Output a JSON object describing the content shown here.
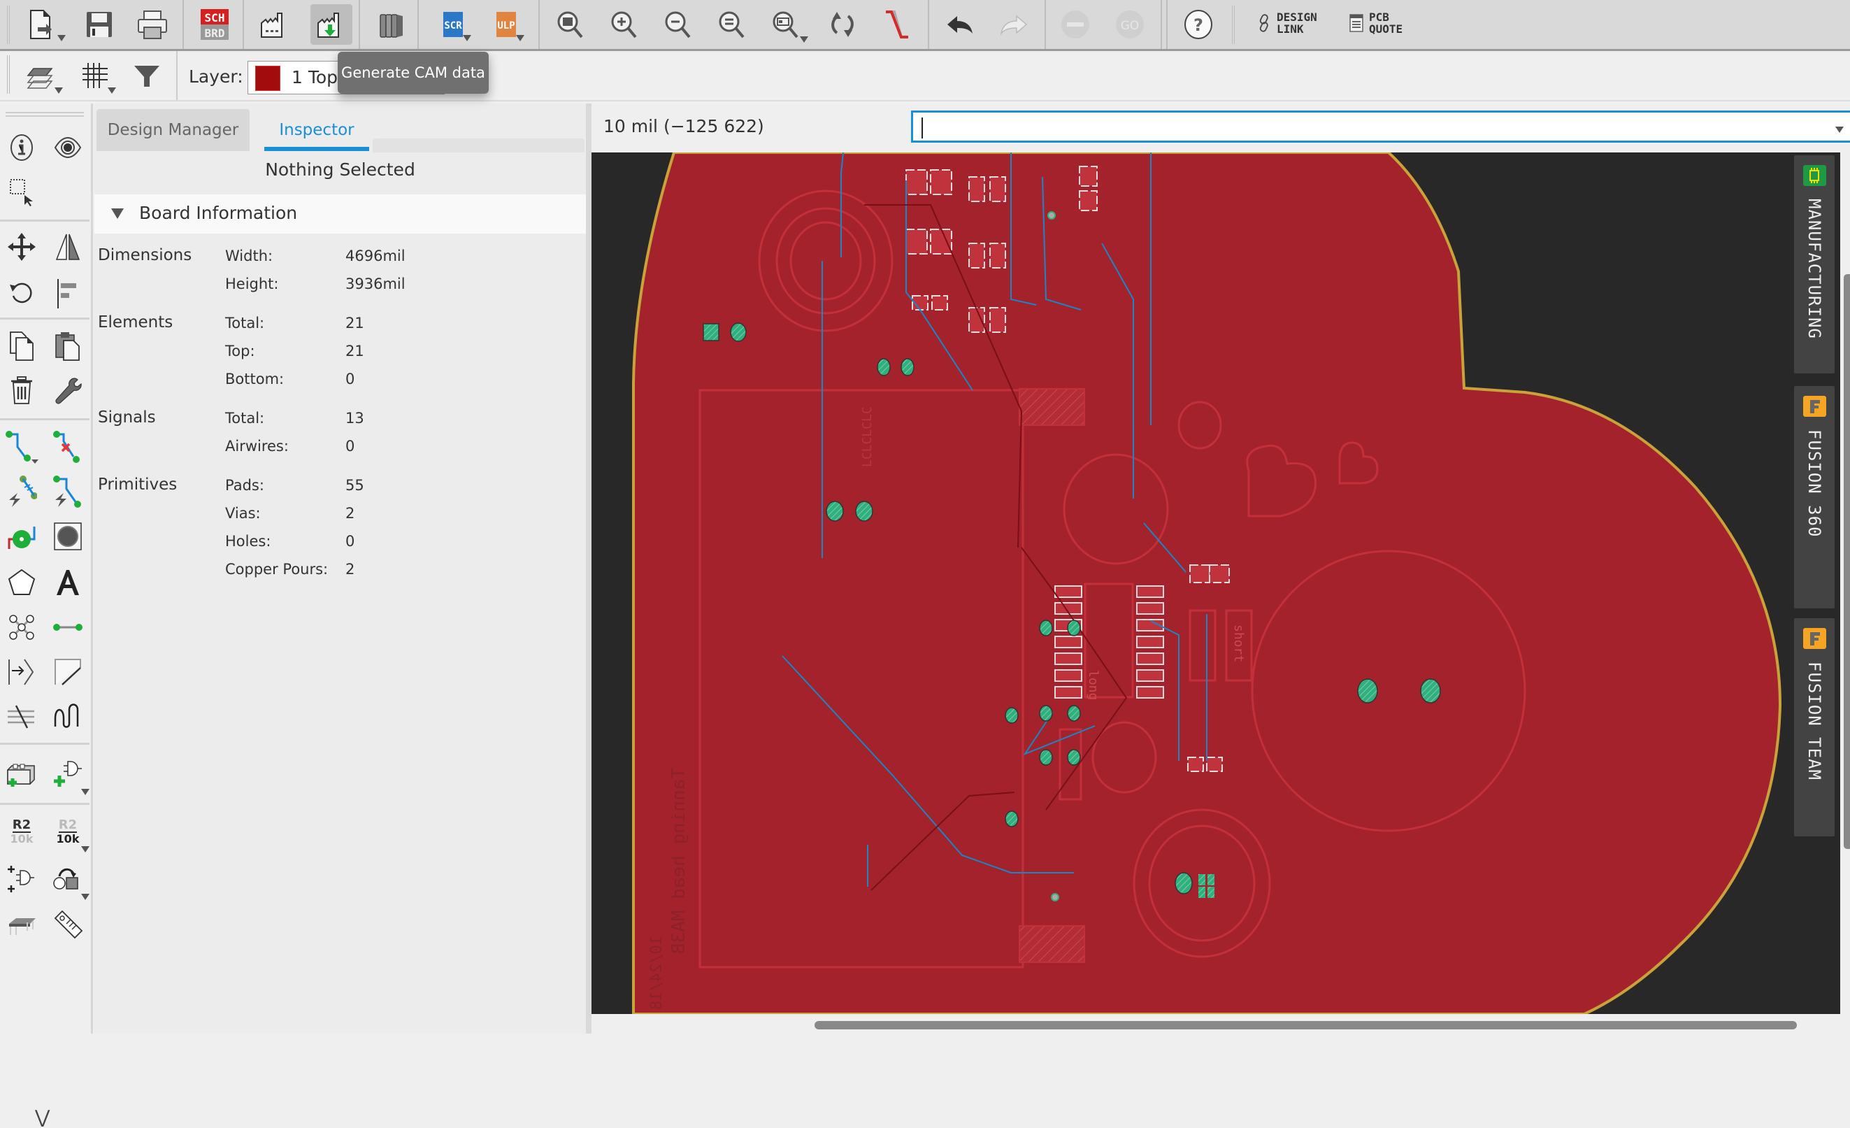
{
  "toolbar": {
    "buttons": [
      {
        "name": "new-file",
        "tooltip": ""
      },
      {
        "name": "save",
        "tooltip": ""
      },
      {
        "name": "print",
        "tooltip": ""
      },
      {
        "name": "sch-brd-switch",
        "label_top": "SCH",
        "label_bottom": "BRD"
      },
      {
        "name": "cam-processor"
      },
      {
        "name": "generate-cam-data",
        "active": true
      },
      {
        "name": "library-manager"
      },
      {
        "name": "run-script",
        "label": "SCR"
      },
      {
        "name": "run-ulp",
        "label": "ULP"
      },
      {
        "name": "zoom-to-fit"
      },
      {
        "name": "zoom-in"
      },
      {
        "name": "zoom-out"
      },
      {
        "name": "zoom-reset"
      },
      {
        "name": "zoom-select"
      },
      {
        "name": "redraw"
      },
      {
        "name": "ratsnest"
      },
      {
        "name": "undo"
      },
      {
        "name": "redo",
        "disabled": true
      },
      {
        "name": "stop",
        "disabled": true
      },
      {
        "name": "go",
        "label": "GO",
        "disabled": true
      },
      {
        "name": "help",
        "label": "?"
      }
    ],
    "design_link": {
      "line1": "DESIGN",
      "line2": "LINK"
    },
    "pcb_quote": {
      "line1": "PCB",
      "line2": "QUOTE"
    }
  },
  "toolbar2": {
    "layer_label": "Layer:",
    "layer_value": "1 Top",
    "layer_color": "#a30c0c"
  },
  "tooltip": "Generate CAM data",
  "inspector": {
    "tabs": [
      {
        "label": "Design Manager",
        "active": false
      },
      {
        "label": "Inspector",
        "active": true
      }
    ],
    "selection_status": "Nothing Selected",
    "section_title": "Board Information",
    "groups": [
      {
        "title": "Dimensions",
        "rows": [
          {
            "key": "Width:",
            "value": "4696mil"
          },
          {
            "key": "Height:",
            "value": "3936mil"
          }
        ]
      },
      {
        "title": "Elements",
        "rows": [
          {
            "key": "Total:",
            "value": "21"
          },
          {
            "key": "Top:",
            "value": "21"
          },
          {
            "key": "Bottom:",
            "value": "0"
          }
        ]
      },
      {
        "title": "Signals",
        "rows": [
          {
            "key": "Total:",
            "value": "13"
          },
          {
            "key": "Airwires:",
            "value": "0"
          }
        ]
      },
      {
        "title": "Primitives",
        "rows": [
          {
            "key": "Pads:",
            "value": "55"
          },
          {
            "key": "Vias:",
            "value": "2"
          },
          {
            "key": "Holes:",
            "value": "0"
          },
          {
            "key": "Copper Pours:",
            "value": "2"
          }
        ]
      }
    ]
  },
  "canvas": {
    "coordinate_readout": "10 mil (−125 622)",
    "command_value": "",
    "board_labels": {
      "resistor_long": "long",
      "resistor_short": "short",
      "bottom_text_1": "Tanning head MA3B",
      "bottom_text_2": "10/24/18",
      "vertical_text": "LCLCLCLC"
    },
    "colors": {
      "background": "#282828",
      "copper_top": "#a3222c",
      "outline": "#c9a23a",
      "trace_bottom": "#1a86c8",
      "pad": "#2fb07e",
      "silk": "#c4303a"
    }
  },
  "side_panel": {
    "tabs": [
      {
        "label": "MANUFACTURING",
        "icon": "pcb-chip-icon"
      },
      {
        "label": "FUSION 360",
        "icon": "fusion-icon"
      },
      {
        "label": "FUSION TEAM",
        "icon": "fusion-icon"
      }
    ]
  },
  "palette": {
    "r2_top": "R2",
    "r2_bottom": "10k"
  }
}
